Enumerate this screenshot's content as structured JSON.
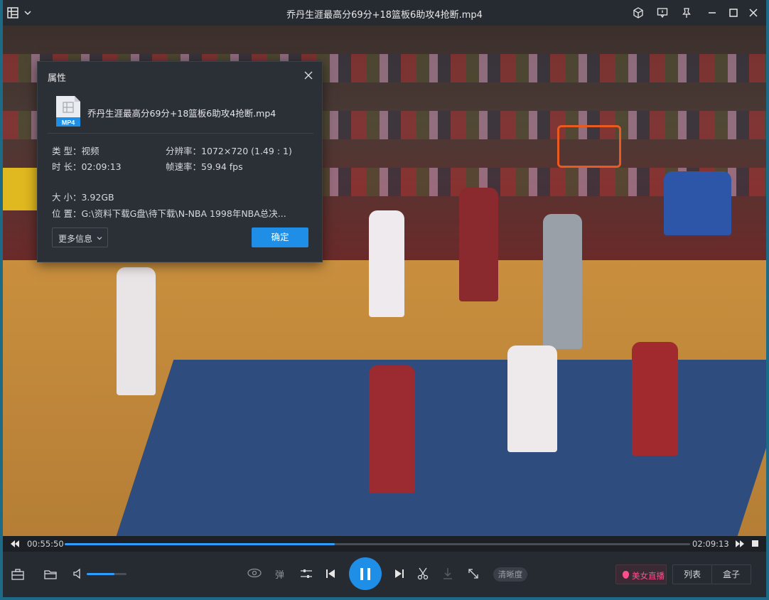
{
  "window": {
    "title": "乔丹生涯最高分69分+18篮板6助攻4抢断.mp4"
  },
  "dialog": {
    "title": "属性",
    "file_type_badge": "MP4",
    "file_name": "乔丹生涯最高分69分+18篮板6助攻4抢断.mp4",
    "type_label": "类 型：",
    "type_value": "视频",
    "resolution_label": "分辨率：",
    "resolution_value": "1072×720 (1.49 : 1)",
    "duration_label": "时 长：",
    "duration_value": "02:09:13",
    "framerate_label": "帧速率：",
    "framerate_value": "59.94 fps",
    "size_label": "大 小：",
    "size_value": "3.92GB",
    "location_label": "位 置：",
    "location_value": "G:\\资料下载G盘\\待下载\\N-NBA 1998年NBA总决...",
    "more_info": "更多信息",
    "ok": "确定"
  },
  "playback": {
    "current_time": "00:55:50",
    "total_time": "02:09:13",
    "progress": 0.432
  },
  "controls": {
    "danmu": "弹",
    "quality": "清晰度",
    "live": "美女直播",
    "playlist": "列表",
    "box": "盒子",
    "volume": 0.7
  },
  "colors": {
    "accent": "#1f8ee6",
    "progress_fill": "#2f9cff",
    "live_pink": "#ff4f8b"
  }
}
